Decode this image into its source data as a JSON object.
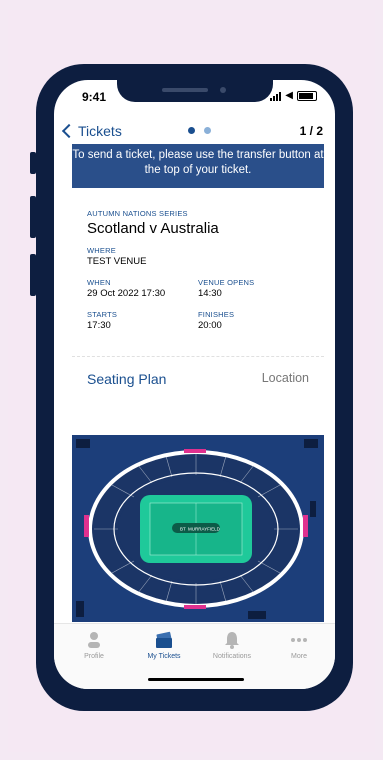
{
  "status": {
    "time": "9:41"
  },
  "nav": {
    "back_label": "Tickets",
    "pager": "1 / 2"
  },
  "banner": {
    "text": "To send a ticket, please use the transfer button at the top of your ticket."
  },
  "ticket": {
    "series": "AUTUMN NATIONS SERIES",
    "match": "Scotland v Australia",
    "where_label": "WHERE",
    "where_value": "TEST VENUE",
    "when_label": "WHEN",
    "when_value": "29 Oct 2022  17:30",
    "opens_label": "VENUE OPENS",
    "opens_value": "14:30",
    "starts_label": "STARTS",
    "starts_value": "17:30",
    "finishes_label": "FINISHES",
    "finishes_value": "20:00"
  },
  "seating": {
    "title": "Seating Plan",
    "location_label": "Location",
    "stadium_name": "MURRAYFIELD",
    "stadium_prefix": "BT"
  },
  "tabs": [
    {
      "label": "Profile",
      "icon": "person-icon"
    },
    {
      "label": "My Tickets",
      "icon": "tickets-icon"
    },
    {
      "label": "Notifications",
      "icon": "bell-icon"
    },
    {
      "label": "More",
      "icon": "more-icon"
    }
  ],
  "colors": {
    "brand": "#1a4f8f",
    "banner": "#2a4f8a",
    "frame": "#0d1e40",
    "pitch": "#1fc99a"
  }
}
